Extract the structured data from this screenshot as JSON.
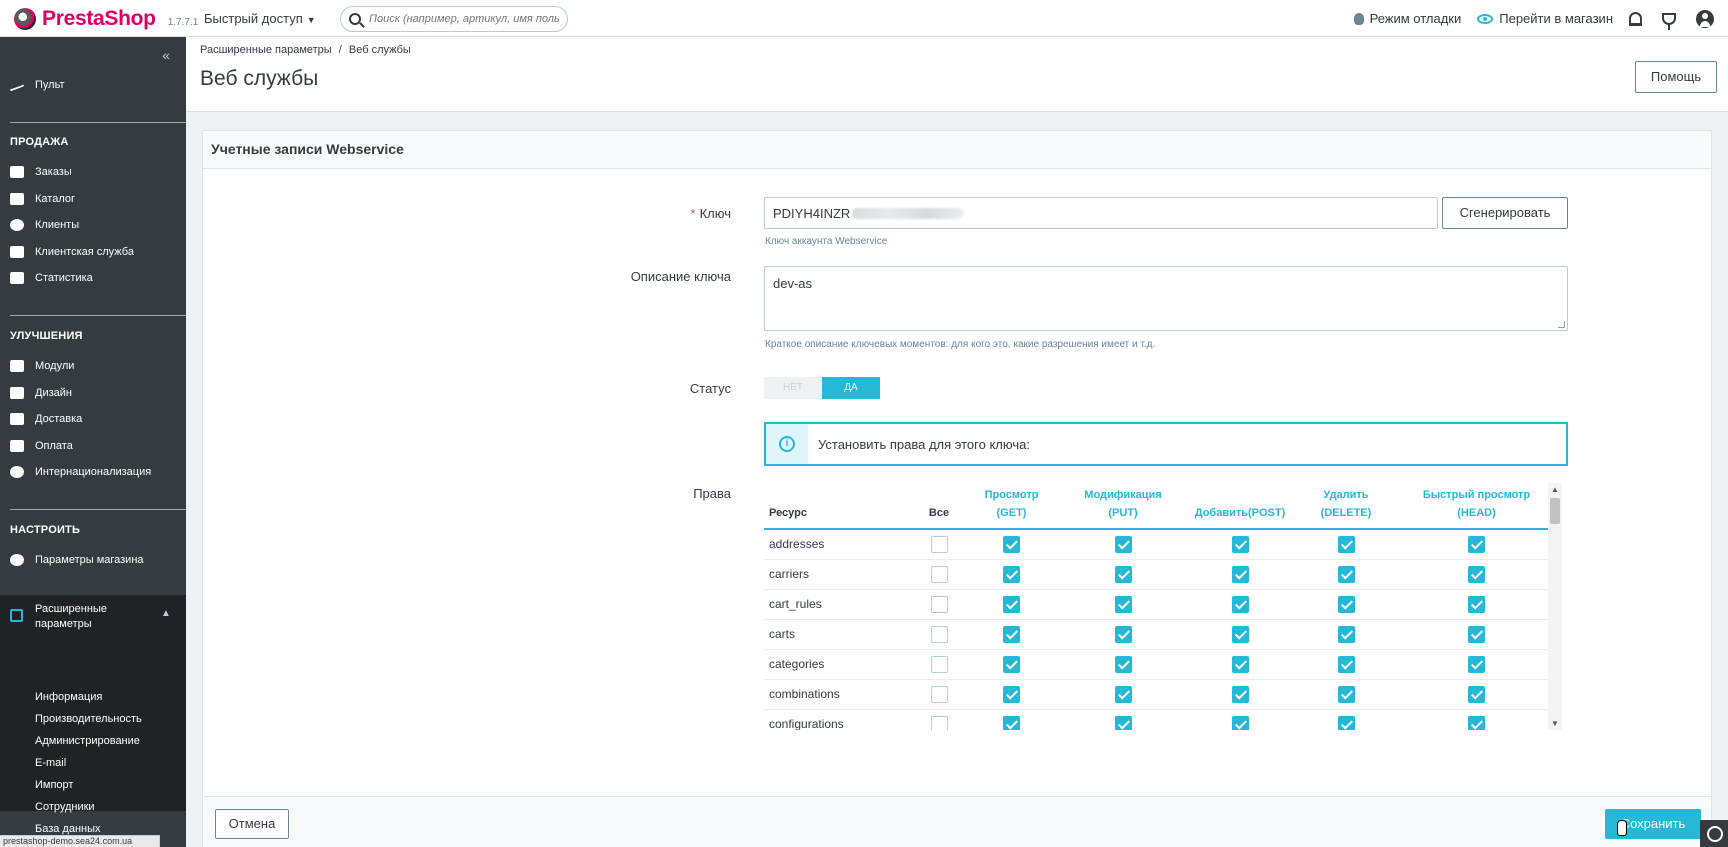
{
  "header": {
    "brand": "PrestaShop",
    "version": "1.7.7.1",
    "quick_access": "Быстрый доступ",
    "search_placeholder": "Поиск (например, артикул, имя поль",
    "debug_mode": "Режим отладки",
    "go_to_shop": "Перейти в магазин"
  },
  "sidebar": {
    "dashboard": "Пульт",
    "sections": [
      {
        "title": "ПРОДАЖА",
        "items": [
          "Заказы",
          "Каталог",
          "Клиенты",
          "Клиентская служба",
          "Статистика"
        ]
      },
      {
        "title": "УЛУЧШЕНИЯ",
        "items": [
          "Модули",
          "Дизайн",
          "Доставка",
          "Оплата",
          "Интернационализация"
        ]
      },
      {
        "title": "НАСТРОИТЬ",
        "items": [
          "Параметры магазина"
        ]
      }
    ],
    "active": "Расширенные параметры",
    "submenu": [
      "Информация",
      "Производительность",
      "Администрирование",
      "E-mail",
      "Импорт",
      "Сотрудники",
      "База данных"
    ]
  },
  "page": {
    "breadcrumb_parent": "Расширенные параметры",
    "breadcrumb_sep": "/",
    "breadcrumb_current": "Веб службы",
    "title": "Веб службы",
    "help_label": "Помощь"
  },
  "form": {
    "card_title": "Учетные записи Webservice",
    "key_required_mark": "*",
    "key_label": "Ключ",
    "key_value": "PDIYH4INZR",
    "generate_label": "Сгенерировать",
    "key_hint": "Ключ аккаунта Webservice",
    "description_label": "Описание ключа",
    "description_value": "dev-as",
    "description_hint": "Краткое описание ключевых моментов: для кого это, какие разрешения имеет и т.д.",
    "status_label": "Статус",
    "status_no": "НЕТ",
    "status_yes": "ДА",
    "status_value": "ДА",
    "info_icon": "info-icon",
    "info_text": "Установить права для этого ключа:",
    "rights_label": "Права",
    "cancel_label": "Отмена",
    "save_label": "Сохранить"
  },
  "permissions": {
    "columns": {
      "resource": "Ресурс",
      "all": "Все",
      "get_line1": "Просмотр",
      "get_line2": "(GET)",
      "put_line1": "Модификация",
      "put_line2": "(PUT)",
      "post_line1": "Добавить(POST)",
      "delete_line1": "Удалить",
      "delete_line2": "(DELETE)",
      "head_line1": "Быстрый просмотр",
      "head_line2": "(HEAD)"
    },
    "rows": [
      {
        "resource": "addresses",
        "all": false,
        "get": true,
        "put": true,
        "post": true,
        "delete": true,
        "head": true
      },
      {
        "resource": "carriers",
        "all": false,
        "get": true,
        "put": true,
        "post": true,
        "delete": true,
        "head": true
      },
      {
        "resource": "cart_rules",
        "all": false,
        "get": true,
        "put": true,
        "post": true,
        "delete": true,
        "head": true
      },
      {
        "resource": "carts",
        "all": false,
        "get": true,
        "put": true,
        "post": true,
        "delete": true,
        "head": true
      },
      {
        "resource": "categories",
        "all": false,
        "get": true,
        "put": true,
        "post": true,
        "delete": true,
        "head": true
      },
      {
        "resource": "combinations",
        "all": false,
        "get": true,
        "put": true,
        "post": true,
        "delete": true,
        "head": true
      },
      {
        "resource": "configurations",
        "all": false,
        "get": true,
        "put": true,
        "post": true,
        "delete": true,
        "head": true
      }
    ]
  },
  "status_url": "prestashop-demo.sea24.com.ua",
  "colors": {
    "accent": "#25b9d7",
    "sidebar_bg": "#363a41",
    "brand_pink": "#df0067"
  }
}
